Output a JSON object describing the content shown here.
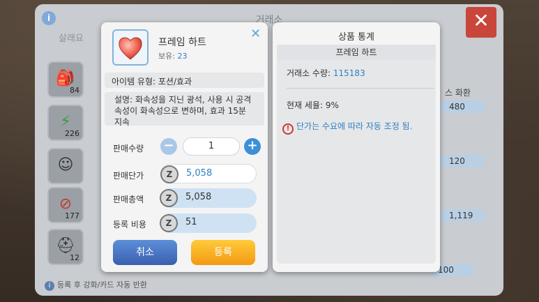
{
  "exchange": {
    "title": "거래소",
    "tab_sell": "살래요",
    "info_icon": "info-icon",
    "close_icon": "close-icon",
    "slots": [
      {
        "count": "84",
        "icon": "bag-icon"
      },
      {
        "count": "226",
        "icon": "lightning-icon"
      },
      {
        "count": "",
        "icon": "character-card-icon"
      },
      {
        "count": "177",
        "icon": "forbidden-icon"
      },
      {
        "count": "12",
        "icon": "helmet-icon"
      }
    ],
    "currency_label": "스 화환",
    "prices": [
      "480",
      "120",
      "1,119",
      "100"
    ],
    "footer_note": "등록 후 강화/카드 자동 반환"
  },
  "sell_dialog": {
    "item_name": "프레임 하트",
    "owned_label": "보유:",
    "owned_value": "23",
    "item_type": "아이템 유형: 포션/효과",
    "description": "설명: 화속성을 지닌 광석, 사용 시 공격 속성이 화속성으로 변하며, 효과 15분 지속",
    "quantity_label": "판매수량",
    "quantity_value": "1",
    "unit_price_label": "판매단가",
    "unit_price_value": "5,058",
    "total_label": "판매총액",
    "total_value": "5,058",
    "fee_label": "등록 비용",
    "fee_value": "51",
    "zeny_symbol": "Z",
    "cancel_label": "취소",
    "register_label": "등록",
    "close_symbol": "✕"
  },
  "stats": {
    "title": "상품 통계",
    "item_name": "프레임 하트",
    "exchange_qty_label": "거래소 수량:",
    "exchange_qty_value": "115183",
    "tax_label": "현재 세율:",
    "tax_value": "9%",
    "notice": "단가는 수요에 따라 자동 조정 됨."
  },
  "colors": {
    "accent_blue": "#2f7fc0",
    "cancel_blue": "#3a5fae",
    "register_orange": "#f29a12",
    "close_red": "#c8473a"
  }
}
